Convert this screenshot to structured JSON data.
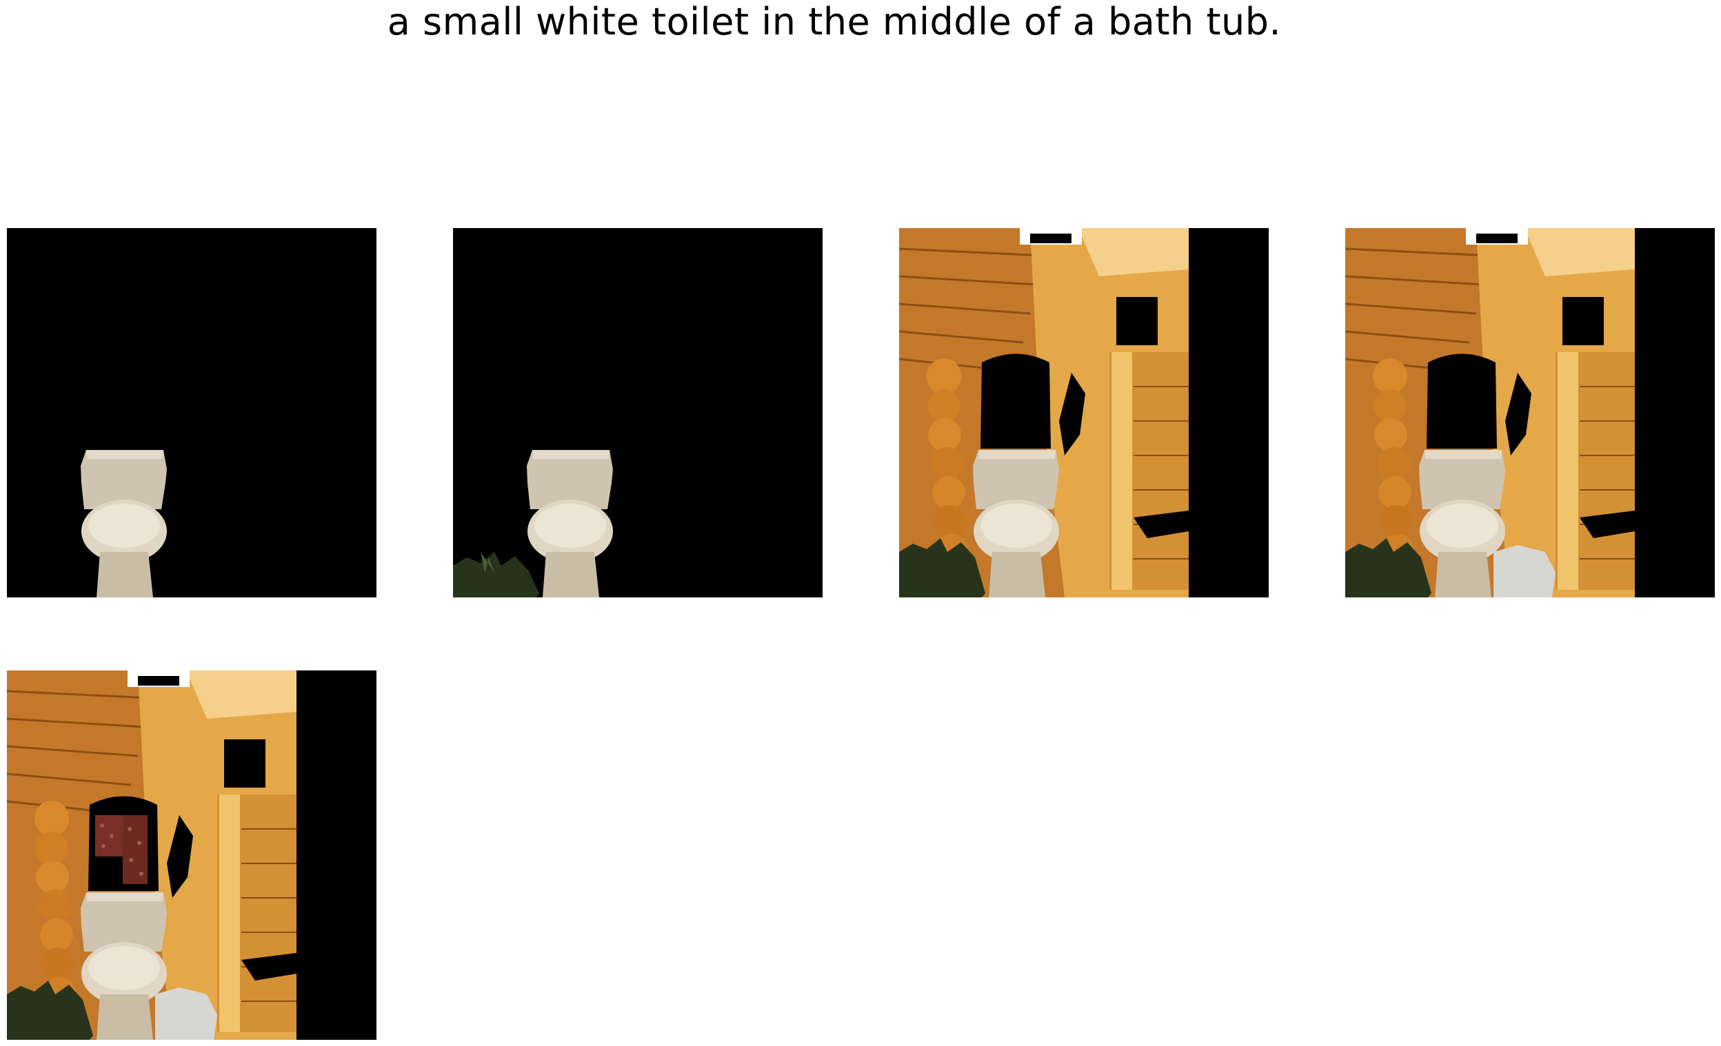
{
  "caption": "a small white toilet in the middle of a bath tub.",
  "panels": [
    {
      "label": "panel-1",
      "stage": 1
    },
    {
      "label": "panel-2",
      "stage": 2
    },
    {
      "label": "panel-3",
      "stage": 3
    },
    {
      "label": "panel-4",
      "stage": 4
    },
    {
      "label": "panel-5",
      "stage": 5
    }
  ],
  "colors": {
    "background": "#000000",
    "wood_light": "#e8a84a",
    "wood_mid": "#c97a26",
    "wood_dark": "#8a4a12",
    "porcelain": "#d9cfbd",
    "porcelain_shadow": "#a89c86",
    "floor_tile": "#d8d8d4",
    "plant": "#2a3a1c",
    "towel": "#7a3028"
  }
}
